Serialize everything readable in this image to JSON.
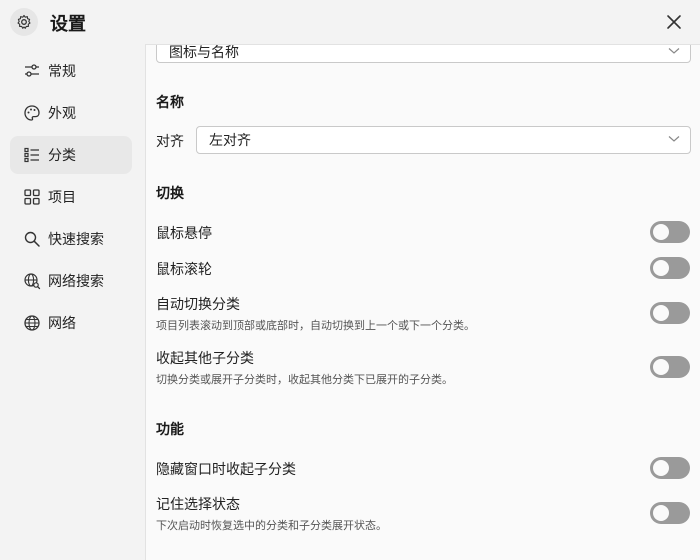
{
  "window": {
    "title": "设置"
  },
  "sidebar": {
    "items": [
      {
        "label": "常规",
        "icon": "sliders-icon"
      },
      {
        "label": "外观",
        "icon": "palette-icon"
      },
      {
        "label": "分类",
        "icon": "list-icon",
        "active": true
      },
      {
        "label": "项目",
        "icon": "grid-icon"
      },
      {
        "label": "快速搜索",
        "icon": "search-icon"
      },
      {
        "label": "网络搜索",
        "icon": "web-search-icon"
      },
      {
        "label": "网络",
        "icon": "globe-icon"
      }
    ]
  },
  "main": {
    "top_select_value": "图标与名称",
    "name_section": {
      "title": "名称",
      "align_label": "对齐",
      "align_value": "左对齐"
    },
    "switch_section": {
      "title": "切换",
      "rows": [
        {
          "label": "鼠标悬停",
          "desc": "",
          "on": false
        },
        {
          "label": "鼠标滚轮",
          "desc": "",
          "on": false
        },
        {
          "label": "自动切换分类",
          "desc": "项目列表滚动到顶部或底部时，自动切换到上一个或下一个分类。",
          "on": false
        },
        {
          "label": "收起其他子分类",
          "desc": "切换分类或展开子分类时，收起其他分类下已展开的子分类。",
          "on": false
        }
      ]
    },
    "function_section": {
      "title": "功能",
      "rows": [
        {
          "label": "隐藏窗口时收起子分类",
          "desc": "",
          "on": false
        },
        {
          "label": "记住选择状态",
          "desc": "下次启动时恢复选中的分类和子分类展开状态。",
          "on": false
        }
      ]
    }
  },
  "colors": {
    "toggle_off": "#9a9a9a",
    "sidebar_bg": "#f3f3f3",
    "panel_bg": "#fafafa",
    "active_item_bg": "#e8e8e8"
  }
}
